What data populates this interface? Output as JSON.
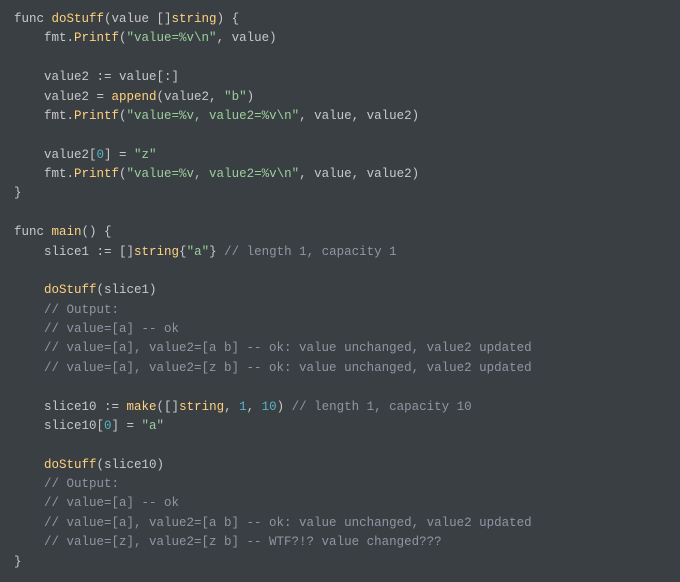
{
  "code": {
    "l1_a": "func ",
    "l1_b": "doStuff",
    "l1_c": "(value []",
    "l1_d": "string",
    "l1_e": ") {",
    "l2_a": "    fmt.",
    "l2_b": "Printf",
    "l2_c": "(",
    "l2_d": "\"value=%v\\n\"",
    "l2_e": ", value)",
    "l3": "",
    "l4_a": "    value2 := value[:]",
    "l5_a": "    value2 = ",
    "l5_b": "append",
    "l5_c": "(value2, ",
    "l5_d": "\"b\"",
    "l5_e": ")",
    "l6_a": "    fmt.",
    "l6_b": "Printf",
    "l6_c": "(",
    "l6_d": "\"value=%v, value2=%v\\n\"",
    "l6_e": ", value, value2)",
    "l7": "",
    "l8_a": "    value2[",
    "l8_b": "0",
    "l8_c": "] = ",
    "l8_d": "\"z\"",
    "l9_a": "    fmt.",
    "l9_b": "Printf",
    "l9_c": "(",
    "l9_d": "\"value=%v, value2=%v\\n\"",
    "l9_e": ", value, value2)",
    "l10_a": "}",
    "l11": "",
    "l12_a": "func ",
    "l12_b": "main",
    "l12_c": "() {",
    "l13_a": "    slice1 := []",
    "l13_b": "string",
    "l13_c": "{",
    "l13_d": "\"a\"",
    "l13_e": "} ",
    "l13_f": "// length 1, capacity 1",
    "l14": "",
    "l15_a": "    ",
    "l15_b": "doStuff",
    "l15_c": "(slice1)",
    "l16_a": "    ",
    "l16_b": "// Output:",
    "l17_a": "    ",
    "l17_b": "// value=[a] -- ok",
    "l18_a": "    ",
    "l18_b": "// value=[a], value2=[a b] -- ok: value unchanged, value2 updated",
    "l19_a": "    ",
    "l19_b": "// value=[a], value2=[z b] -- ok: value unchanged, value2 updated",
    "l20": "",
    "l21_a": "    slice10 := ",
    "l21_b": "make",
    "l21_c": "([]",
    "l21_d": "string",
    "l21_e": ", ",
    "l21_f": "1",
    "l21_g": ", ",
    "l21_h": "10",
    "l21_i": ") ",
    "l21_j": "// length 1, capacity 10",
    "l22_a": "    slice10[",
    "l22_b": "0",
    "l22_c": "] = ",
    "l22_d": "\"a\"",
    "l23": "",
    "l24_a": "    ",
    "l24_b": "doStuff",
    "l24_c": "(slice10)",
    "l25_a": "    ",
    "l25_b": "// Output:",
    "l26_a": "    ",
    "l26_b": "// value=[a] -- ok",
    "l27_a": "    ",
    "l27_b": "// value=[a], value2=[a b] -- ok: value unchanged, value2 updated",
    "l28_a": "    ",
    "l28_b": "// value=[z], value2=[z b] -- WTF?!? value changed???",
    "l29_a": "}"
  }
}
